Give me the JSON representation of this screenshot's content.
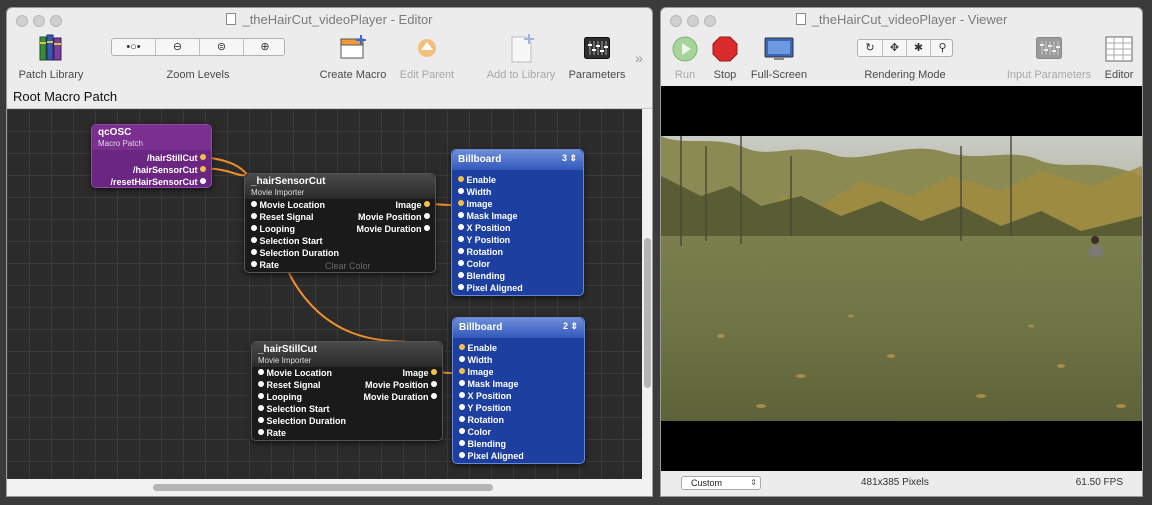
{
  "editor": {
    "title": "_theHairCut_videoPlayer - Editor",
    "toolbar": {
      "patch_library": "Patch Library",
      "zoom_levels": "Zoom Levels",
      "create_macro": "Create Macro",
      "edit_parent": "Edit Parent",
      "add_to_library": "Add to Library",
      "parameters": "Parameters",
      "overflow": "»"
    },
    "breadcrumb": "Root Macro Patch",
    "patches": {
      "qcosc": {
        "name": "qcOSC",
        "type": "Macro Patch",
        "outputs": [
          "/hairStillCut",
          "/hairSensorCut",
          "/resetHairSensorCut"
        ]
      },
      "sensor": {
        "name": "_hairSensorCut",
        "type": "Movie Importer",
        "inputs": [
          "Movie Location",
          "Reset Signal",
          "Looping",
          "Selection Start",
          "Selection Duration",
          "Rate"
        ],
        "outputs": [
          "Image",
          "Movie Position",
          "Movie Duration"
        ],
        "ghost_labels": [
          "Clear Color"
        ]
      },
      "still": {
        "name": "_hairStillCut",
        "type": "Movie Importer",
        "inputs": [
          "Movie Location",
          "Reset Signal",
          "Looping",
          "Selection Start",
          "Selection Duration",
          "Rate"
        ],
        "outputs": [
          "Image",
          "Movie Position",
          "Movie Duration"
        ]
      },
      "billboard1": {
        "name": "Billboard",
        "layer": "3",
        "inputs": [
          "Enable",
          "Width",
          "Image",
          "Mask Image",
          "X Position",
          "Y Position",
          "Rotation",
          "Color",
          "Blending",
          "Pixel Aligned"
        ]
      },
      "billboard2": {
        "name": "Billboard",
        "layer": "2",
        "inputs": [
          "Enable",
          "Width",
          "Image",
          "Mask Image",
          "X Position",
          "Y Position",
          "Rotation",
          "Color",
          "Blending",
          "Pixel Aligned"
        ]
      }
    }
  },
  "viewer": {
    "title": "_theHairCut_videoPlayer - Viewer",
    "toolbar": {
      "run": "Run",
      "stop": "Stop",
      "full_screen": "Full-Screen",
      "rendering_mode": "Rendering Mode",
      "input_parameters": "Input Parameters",
      "editor": "Editor"
    },
    "status": {
      "size_mode": "Custom",
      "resolution": "481x385 Pixels",
      "fps": "61.50 FPS"
    }
  },
  "colors": {
    "macro_patch": "#7b2f90",
    "consumer_patch": "#3158bd",
    "processor_patch": "#2a2a2a",
    "connection": "#f0902a"
  }
}
